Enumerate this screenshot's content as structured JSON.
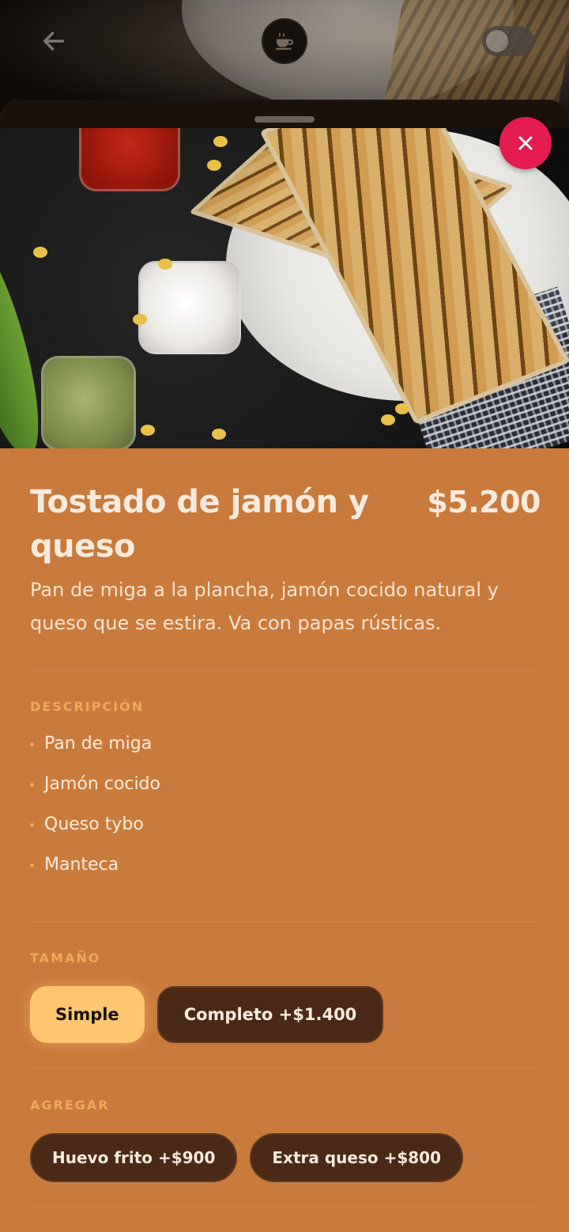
{
  "header": {
    "back_icon": "arrow-left-icon",
    "logo_icon": "coffee-cup-icon",
    "toggle_state": "off"
  },
  "sheet": {
    "close_icon": "close-icon",
    "colors": {
      "close_bg": "#e41c4f",
      "sheet_bg": "#c97a3d",
      "accent": "#eea85b",
      "chip_active": "#fec66f",
      "chip_dark": "#4a2a16"
    }
  },
  "product": {
    "title": "Tostado de jamón y queso",
    "price": "$5.200",
    "summary": "Pan de miga a la plancha, jamón cocido natural y queso que se estira. Va con papas rústicas."
  },
  "description": {
    "label": "DESCRIPCIÓN",
    "items": [
      "Pan de miga",
      "Jamón cocido",
      "Queso tybo",
      "Manteca"
    ]
  },
  "size": {
    "label": "TAMAÑO",
    "options": [
      {
        "label": "Simple",
        "selected": true
      },
      {
        "label": "Completo +$1.400",
        "selected": false
      }
    ]
  },
  "extras": {
    "label": "AGREGAR",
    "options": [
      {
        "label": "Huevo frito +$900"
      },
      {
        "label": "Extra queso +$800"
      }
    ]
  }
}
